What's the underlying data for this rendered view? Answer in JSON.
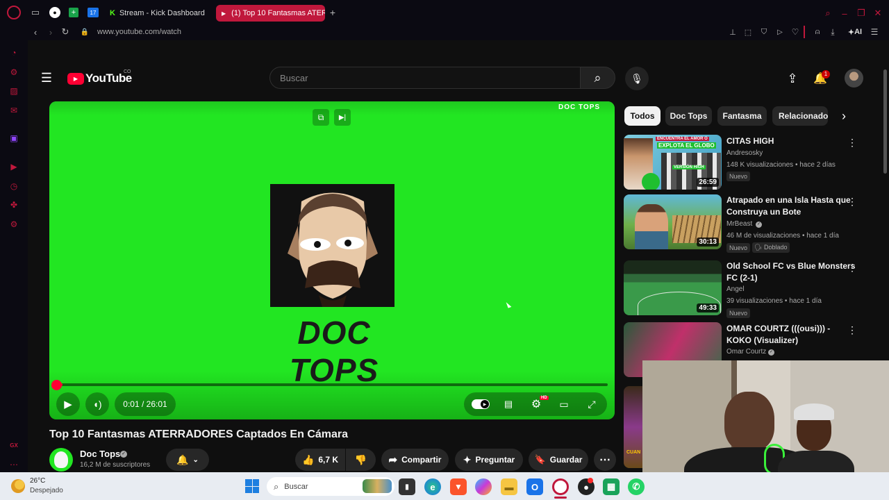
{
  "browser": {
    "tabs": [
      {
        "label": "Stream - Kick Dashboard"
      },
      {
        "label": "(1) Top 10 Fantasmas ATER"
      }
    ],
    "url": "www.youtube.com/watch",
    "ai_label": "AI"
  },
  "youtube": {
    "logo": "YouTube",
    "country": "CO",
    "search_placeholder": "Buscar",
    "notif_count": "1",
    "chips": [
      "Todos",
      "Doc Tops",
      "Fantasma",
      "Relacionado"
    ],
    "player": {
      "watermark": "DOC TOPS",
      "channel_art_text": "DOC TOPS",
      "time": "0:01 / 26:01",
      "progress": 0.0006,
      "hd": "HD"
    },
    "video": {
      "title": "Top 10 Fantasmas ATERRADORES Captados En Cámara",
      "channel": "Doc Tops",
      "subscribers": "16,2 M de suscriptores",
      "likes": "6,7 K",
      "share": "Compartir",
      "ask": "Preguntar",
      "save": "Guardar"
    },
    "recs": [
      {
        "title1": "CITAS HIGH",
        "title2": "",
        "channel": "Andresosky",
        "meta": "148 K visualizaciones • hace 2 días",
        "badge": "Nuevo",
        "badge2": "",
        "duration": "26:59",
        "thumb_text1": "ENCUENTRA EL AMOR O",
        "thumb_text2": "EXPLOTA EL GLOBO",
        "thumb_text3": "VERSIÓN HIGH"
      },
      {
        "title1": "Atrapado en una Isla Hasta que",
        "title2": "Construya un Bote",
        "channel": "MrBeast",
        "meta": "46 M de visualizaciones • hace 1 día",
        "badge": "Nuevo",
        "badge2": "Doblado",
        "duration": "30:13"
      },
      {
        "title1": "Old School FC vs Blue Monsters",
        "title2": "FC (2-1)",
        "channel": "Angel",
        "meta": "39 visualizaciones • hace 1 día",
        "badge": "Nuevo",
        "badge2": "",
        "duration": "49:33"
      },
      {
        "title1": "OMAR COURTZ (((ousi))) -",
        "title2": "KOKO (Visualizer)",
        "channel": "Omar Courtz",
        "meta": "",
        "badge": "",
        "badge2": "",
        "duration": ""
      }
    ],
    "partial_thumb_text": "CUAN"
  },
  "taskbar": {
    "temp": "26°C",
    "weather": "Despejado",
    "search": "Buscar"
  },
  "colors": {
    "accent_red": "#ff0033",
    "opera_red": "#c0183c",
    "green_screen": "#22e622"
  }
}
